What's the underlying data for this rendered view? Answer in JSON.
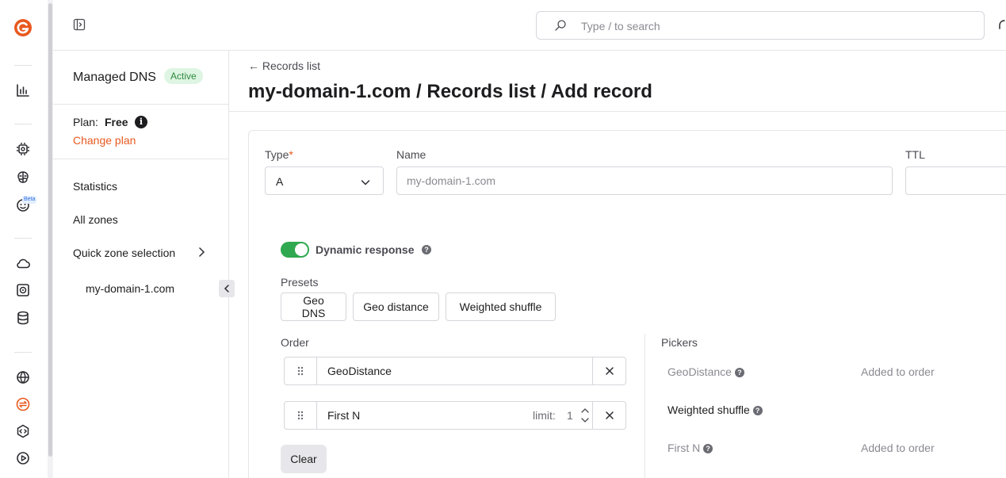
{
  "search": {
    "placeholder": "Type / to search"
  },
  "rail": {
    "beta_badge": "Beta"
  },
  "subnav": {
    "service_title": "Managed DNS",
    "status_badge": "Active",
    "plan_label": "Plan:",
    "plan_value": "Free",
    "change_plan": "Change plan",
    "items": [
      {
        "label": "Statistics"
      },
      {
        "label": "All zones"
      },
      {
        "label": "Quick zone selection"
      }
    ],
    "zone": "my-domain-1.com"
  },
  "main": {
    "back_link": "← Records list",
    "title": "my-domain-1.com / Records list / Add record"
  },
  "form": {
    "type_label": "Type",
    "type_required": "*",
    "type_value": "A",
    "name_label": "Name",
    "name_placeholder": "my-domain-1.com",
    "ttl_label": "TTL",
    "dynamic_response_label": "Dynamic response",
    "dynamic_response_enabled": true,
    "presets_label": "Presets",
    "presets": [
      "Geo DNS",
      "Geo distance",
      "Weighted shuffle"
    ],
    "order_label": "Order",
    "order": [
      {
        "name": "GeoDistance"
      },
      {
        "name": "First N",
        "limit_label": "limit:",
        "limit_value": "1"
      }
    ],
    "clear_label": "Clear",
    "pickers_label": "Pickers",
    "pickers": [
      {
        "name": "GeoDistance",
        "status": "Added to order"
      },
      {
        "name": "Weighted shuffle",
        "status": ""
      },
      {
        "name": "First N",
        "status": "Added to order"
      }
    ]
  },
  "colors": {
    "accent": "#e8591f",
    "toggle_on": "#2fa84f",
    "badge_bg": "#dff5e3",
    "badge_text": "#2e8b3e"
  }
}
